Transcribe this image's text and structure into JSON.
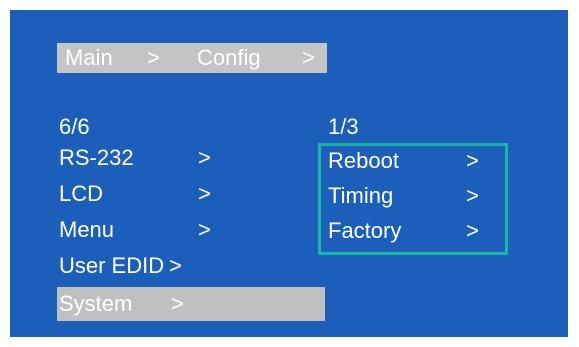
{
  "breadcrumb": {
    "main": "Main",
    "sep1": ">",
    "config": "Config",
    "sep2": ">"
  },
  "left_menu": {
    "page_indicator": "6/6",
    "items": [
      {
        "label": "RS-232",
        "arrow": ">"
      },
      {
        "label": "LCD",
        "arrow": ">"
      },
      {
        "label": "Menu",
        "arrow": ">"
      },
      {
        "label": "User EDID",
        "arrow": ">"
      },
      {
        "label": "System",
        "arrow": ">",
        "selected": true
      }
    ]
  },
  "right_menu": {
    "page_indicator": "1/3",
    "items": [
      {
        "label": "Reboot",
        "arrow": ">"
      },
      {
        "label": "Timing",
        "arrow": ">"
      },
      {
        "label": "Factory",
        "arrow": ">"
      }
    ]
  },
  "colors": {
    "background": "#1c5fbb",
    "highlight": "#c4c4c4",
    "selection_border": "#19b6a1",
    "text": "#ffffff"
  }
}
